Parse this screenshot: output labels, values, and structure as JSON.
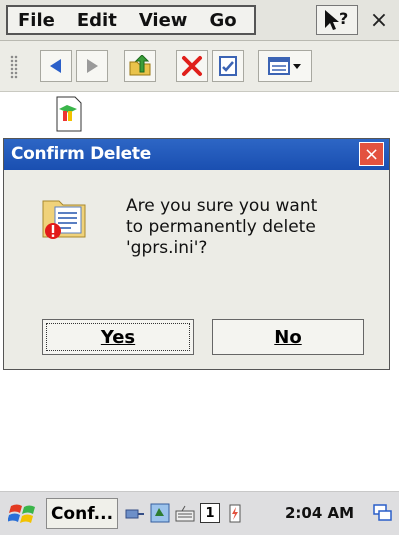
{
  "menu": {
    "items": [
      "File",
      "Edit",
      "View",
      "Go"
    ],
    "help": "?",
    "close": "×"
  },
  "toolbar": {
    "buttons": [
      "back",
      "forward",
      "up-folder",
      "delete",
      "properties",
      "view-menu"
    ]
  },
  "dialog": {
    "title": "Confirm Delete",
    "close_label": "×",
    "message": [
      "Are you sure you want",
      "to permanently delete",
      "'gprs.ini'?"
    ],
    "yes_label": "Yes",
    "no_label": "No"
  },
  "taskbar": {
    "task_label": "Conf...",
    "input_indicator": "1",
    "clock": "2:04 AM"
  },
  "colors": {
    "title_bar": "#1a4fb1",
    "close_button": "#e3523f"
  }
}
